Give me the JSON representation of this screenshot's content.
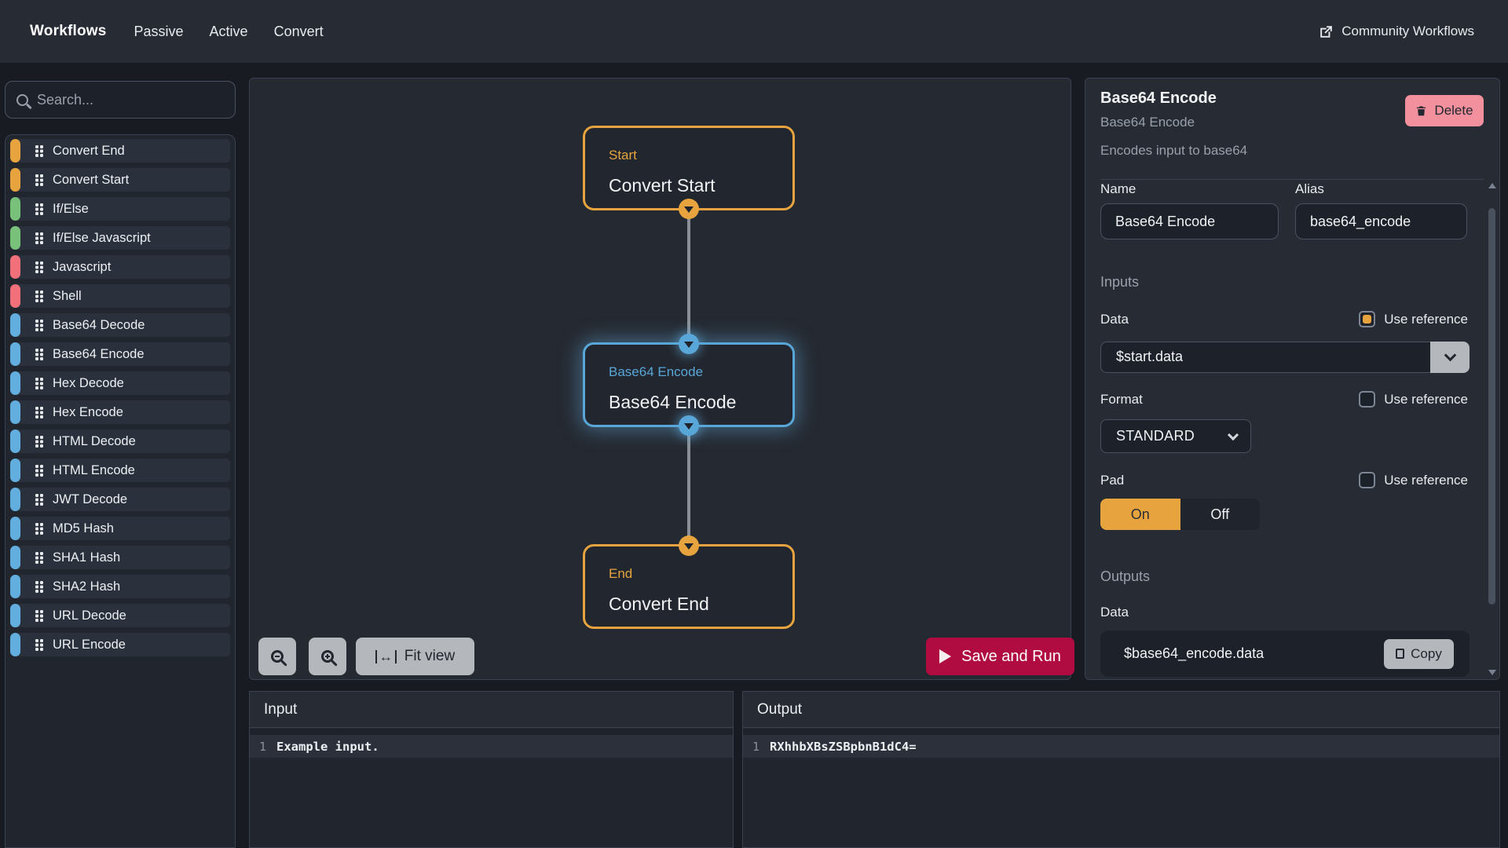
{
  "nav": {
    "brand": "Workflows",
    "tabs": [
      "Passive",
      "Active",
      "Convert"
    ],
    "community_link": "Community Workflows"
  },
  "sidebar": {
    "search_placeholder": "Search...",
    "items": [
      {
        "label": "Convert End",
        "color": "orange"
      },
      {
        "label": "Convert Start",
        "color": "orange"
      },
      {
        "label": "If/Else",
        "color": "green"
      },
      {
        "label": "If/Else Javascript",
        "color": "green"
      },
      {
        "label": "Javascript",
        "color": "pink"
      },
      {
        "label": "Shell",
        "color": "pink"
      },
      {
        "label": "Base64 Decode",
        "color": "blue"
      },
      {
        "label": "Base64 Encode",
        "color": "blue"
      },
      {
        "label": "Hex Decode",
        "color": "blue"
      },
      {
        "label": "Hex Encode",
        "color": "blue"
      },
      {
        "label": "HTML Decode",
        "color": "blue"
      },
      {
        "label": "HTML Encode",
        "color": "blue"
      },
      {
        "label": "JWT Decode",
        "color": "blue"
      },
      {
        "label": "MD5 Hash",
        "color": "blue"
      },
      {
        "label": "SHA1 Hash",
        "color": "blue"
      },
      {
        "label": "SHA2 Hash",
        "color": "blue"
      },
      {
        "label": "URL Decode",
        "color": "blue"
      },
      {
        "label": "URL Encode",
        "color": "blue"
      }
    ]
  },
  "canvas": {
    "nodes": [
      {
        "label": "Start",
        "title": "Convert Start",
        "accent": "orange",
        "selected": false
      },
      {
        "label": "Base64 Encode",
        "title": "Base64 Encode",
        "accent": "blue",
        "selected": true
      },
      {
        "label": "End",
        "title": "Convert End",
        "accent": "orange",
        "selected": false
      }
    ],
    "fit_view_label": "Fit view",
    "run_label": "Save and Run"
  },
  "inspector": {
    "title": "Base64 Encode",
    "subtitle": "Base64 Encode",
    "description": "Encodes input to base64",
    "delete_label": "Delete",
    "name_field": {
      "label": "Name",
      "value": "Base64 Encode"
    },
    "alias_field": {
      "label": "Alias",
      "value": "base64_encode"
    },
    "inputs_heading": "Inputs",
    "data_field": {
      "label": "Data",
      "use_reference": "Use reference",
      "checked": true,
      "value": "$start.data"
    },
    "format_field": {
      "label": "Format",
      "use_reference": "Use reference",
      "checked": false,
      "value": "STANDARD"
    },
    "pad_field": {
      "label": "Pad",
      "use_reference": "Use reference",
      "checked": false,
      "on_label": "On",
      "off_label": "Off",
      "selected": "On"
    },
    "outputs_heading": "Outputs",
    "output_field": {
      "label": "Data",
      "value": "$base64_encode.data",
      "copy_label": "Copy"
    }
  },
  "io": {
    "input": {
      "title": "Input",
      "lines": [
        {
          "num": "1",
          "text": "Example input."
        }
      ]
    },
    "output": {
      "title": "Output",
      "lines": [
        {
          "num": "1",
          "text": "RXhhbXBsZSBpbnB1dC4="
        }
      ]
    }
  },
  "icons": {
    "search": "magnifier",
    "external_link": "arrow-out-of-box",
    "drag_handle": "six-dots",
    "zoom_out": "magnifier-minus",
    "zoom_in": "magnifier-plus",
    "fit_view": "bar-left-right-arrow-bar",
    "play": "triangle-right",
    "trash": "trash-can",
    "chevron_down": "chevron-down",
    "copy": "two-sheets",
    "scroll_up": "triangle-up",
    "scroll_down": "triangle-down",
    "output_port": "circle-triangle-down",
    "input_port": "circle-triangle-down"
  },
  "colors": {
    "page-bg": "#181b21",
    "panel-bg": "#262b34",
    "canvas-bg": "#252931",
    "node-bg": "#22262e",
    "item-bg": "#2b313c",
    "input-bg": "#1d2129",
    "input-border": "#4a5262",
    "border": "#3a4150",
    "gray-text": "#99a0ab",
    "orange": "#e7a43e",
    "green": "#77c17b",
    "pink": "#f1707a",
    "blue": "#62aede",
    "node-blue": "#58a7d8",
    "crimson": "#b10c41",
    "delete-pink": "#f2919d",
    "gray-btn": "#b4b7bb",
    "dark-icon": "#22262e",
    "edge": "#8b9097"
  }
}
